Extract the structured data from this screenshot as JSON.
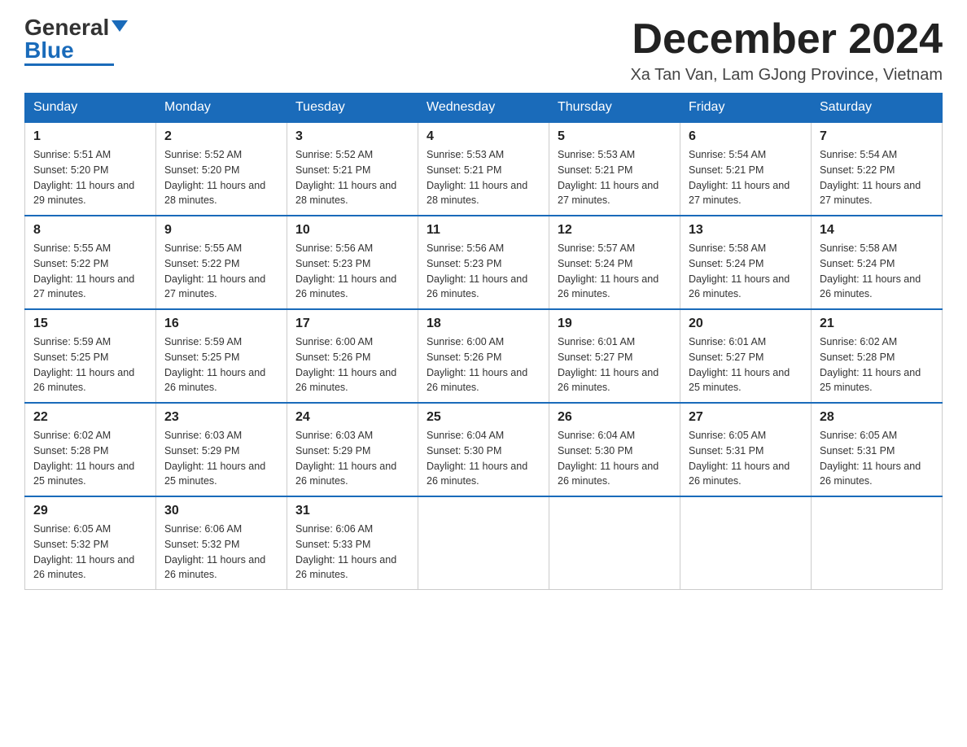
{
  "logo": {
    "general": "General",
    "blue": "Blue"
  },
  "title": "December 2024",
  "subtitle": "Xa Tan Van, Lam GJong Province, Vietnam",
  "weekdays": [
    "Sunday",
    "Monday",
    "Tuesday",
    "Wednesday",
    "Thursday",
    "Friday",
    "Saturday"
  ],
  "weeks": [
    [
      {
        "day": "1",
        "sunrise": "5:51 AM",
        "sunset": "5:20 PM",
        "daylight": "11 hours and 29 minutes."
      },
      {
        "day": "2",
        "sunrise": "5:52 AM",
        "sunset": "5:20 PM",
        "daylight": "11 hours and 28 minutes."
      },
      {
        "day": "3",
        "sunrise": "5:52 AM",
        "sunset": "5:21 PM",
        "daylight": "11 hours and 28 minutes."
      },
      {
        "day": "4",
        "sunrise": "5:53 AM",
        "sunset": "5:21 PM",
        "daylight": "11 hours and 28 minutes."
      },
      {
        "day": "5",
        "sunrise": "5:53 AM",
        "sunset": "5:21 PM",
        "daylight": "11 hours and 27 minutes."
      },
      {
        "day": "6",
        "sunrise": "5:54 AM",
        "sunset": "5:21 PM",
        "daylight": "11 hours and 27 minutes."
      },
      {
        "day": "7",
        "sunrise": "5:54 AM",
        "sunset": "5:22 PM",
        "daylight": "11 hours and 27 minutes."
      }
    ],
    [
      {
        "day": "8",
        "sunrise": "5:55 AM",
        "sunset": "5:22 PM",
        "daylight": "11 hours and 27 minutes."
      },
      {
        "day": "9",
        "sunrise": "5:55 AM",
        "sunset": "5:22 PM",
        "daylight": "11 hours and 27 minutes."
      },
      {
        "day": "10",
        "sunrise": "5:56 AM",
        "sunset": "5:23 PM",
        "daylight": "11 hours and 26 minutes."
      },
      {
        "day": "11",
        "sunrise": "5:56 AM",
        "sunset": "5:23 PM",
        "daylight": "11 hours and 26 minutes."
      },
      {
        "day": "12",
        "sunrise": "5:57 AM",
        "sunset": "5:24 PM",
        "daylight": "11 hours and 26 minutes."
      },
      {
        "day": "13",
        "sunrise": "5:58 AM",
        "sunset": "5:24 PM",
        "daylight": "11 hours and 26 minutes."
      },
      {
        "day": "14",
        "sunrise": "5:58 AM",
        "sunset": "5:24 PM",
        "daylight": "11 hours and 26 minutes."
      }
    ],
    [
      {
        "day": "15",
        "sunrise": "5:59 AM",
        "sunset": "5:25 PM",
        "daylight": "11 hours and 26 minutes."
      },
      {
        "day": "16",
        "sunrise": "5:59 AM",
        "sunset": "5:25 PM",
        "daylight": "11 hours and 26 minutes."
      },
      {
        "day": "17",
        "sunrise": "6:00 AM",
        "sunset": "5:26 PM",
        "daylight": "11 hours and 26 minutes."
      },
      {
        "day": "18",
        "sunrise": "6:00 AM",
        "sunset": "5:26 PM",
        "daylight": "11 hours and 26 minutes."
      },
      {
        "day": "19",
        "sunrise": "6:01 AM",
        "sunset": "5:27 PM",
        "daylight": "11 hours and 26 minutes."
      },
      {
        "day": "20",
        "sunrise": "6:01 AM",
        "sunset": "5:27 PM",
        "daylight": "11 hours and 25 minutes."
      },
      {
        "day": "21",
        "sunrise": "6:02 AM",
        "sunset": "5:28 PM",
        "daylight": "11 hours and 25 minutes."
      }
    ],
    [
      {
        "day": "22",
        "sunrise": "6:02 AM",
        "sunset": "5:28 PM",
        "daylight": "11 hours and 25 minutes."
      },
      {
        "day": "23",
        "sunrise": "6:03 AM",
        "sunset": "5:29 PM",
        "daylight": "11 hours and 25 minutes."
      },
      {
        "day": "24",
        "sunrise": "6:03 AM",
        "sunset": "5:29 PM",
        "daylight": "11 hours and 26 minutes."
      },
      {
        "day": "25",
        "sunrise": "6:04 AM",
        "sunset": "5:30 PM",
        "daylight": "11 hours and 26 minutes."
      },
      {
        "day": "26",
        "sunrise": "6:04 AM",
        "sunset": "5:30 PM",
        "daylight": "11 hours and 26 minutes."
      },
      {
        "day": "27",
        "sunrise": "6:05 AM",
        "sunset": "5:31 PM",
        "daylight": "11 hours and 26 minutes."
      },
      {
        "day": "28",
        "sunrise": "6:05 AM",
        "sunset": "5:31 PM",
        "daylight": "11 hours and 26 minutes."
      }
    ],
    [
      {
        "day": "29",
        "sunrise": "6:05 AM",
        "sunset": "5:32 PM",
        "daylight": "11 hours and 26 minutes."
      },
      {
        "day": "30",
        "sunrise": "6:06 AM",
        "sunset": "5:32 PM",
        "daylight": "11 hours and 26 minutes."
      },
      {
        "day": "31",
        "sunrise": "6:06 AM",
        "sunset": "5:33 PM",
        "daylight": "11 hours and 26 minutes."
      },
      null,
      null,
      null,
      null
    ]
  ]
}
